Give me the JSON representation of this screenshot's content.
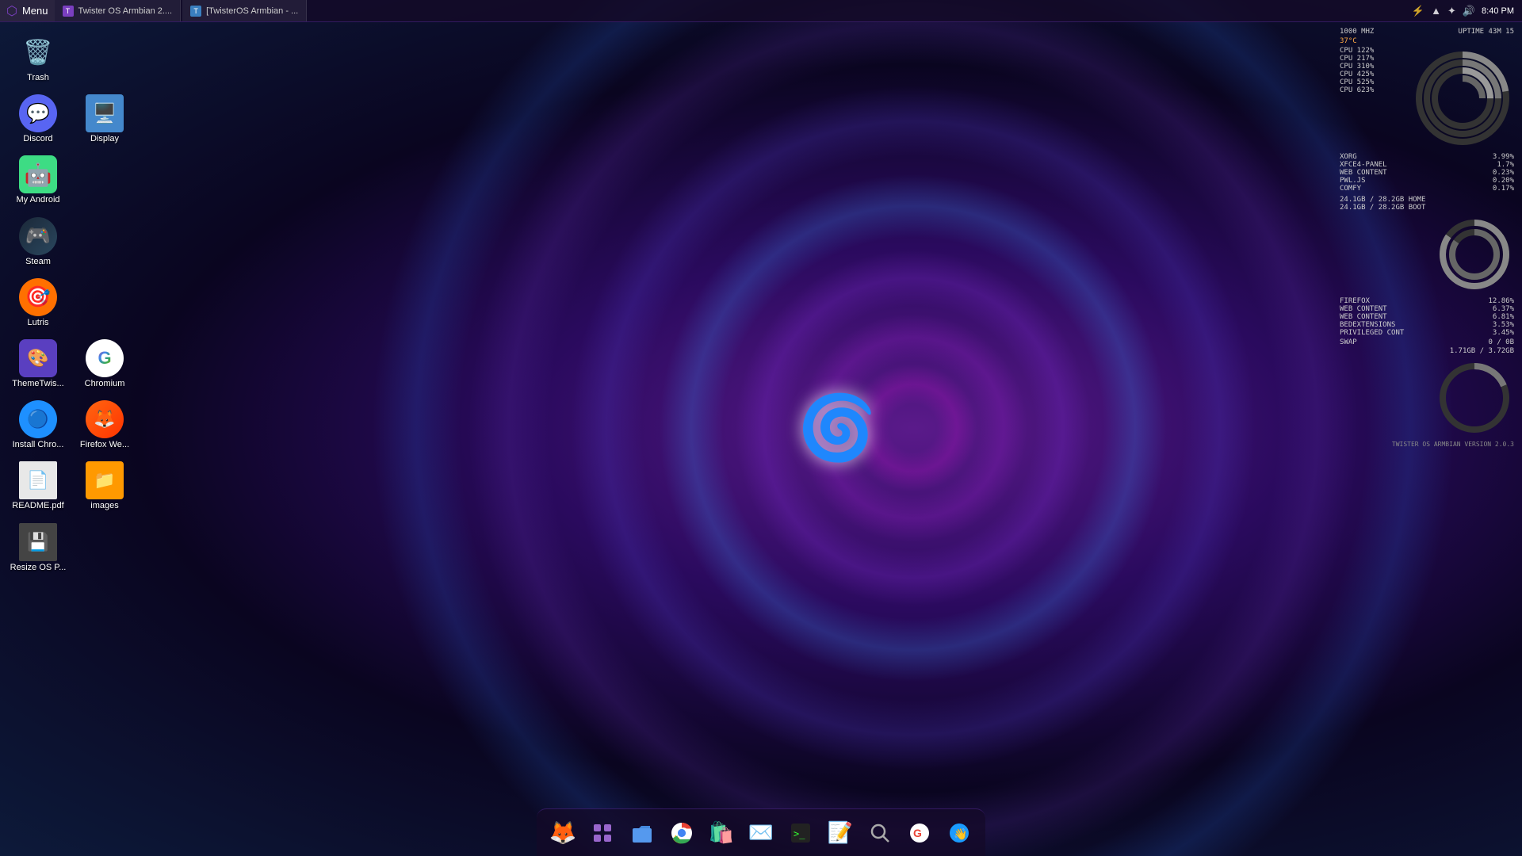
{
  "taskbar": {
    "menu_label": "Menu",
    "tab1_label": "Twister OS Armbian 2....",
    "tab2_label": "[TwisterOS Armbian - ...",
    "time": "8:40 PM",
    "icons": {
      "battery": "⚡",
      "wifi": "📶",
      "bluetooth": "🔵",
      "volume": "🔊"
    }
  },
  "desktop_icons": [
    {
      "id": "trash",
      "label": "Trash",
      "emoji": "🗑️",
      "color": "#888"
    },
    {
      "id": "discord",
      "label": "Discord",
      "emoji": "💬",
      "bg": "#5865F2"
    },
    {
      "id": "display",
      "label": "Display",
      "emoji": "🖥️",
      "bg": "#4a9eff"
    },
    {
      "id": "my-android",
      "label": "My Android",
      "emoji": "🤖",
      "bg": "#3ddc84"
    },
    {
      "id": "steam",
      "label": "Steam",
      "emoji": "🎮",
      "bg": "#1b2838"
    },
    {
      "id": "lutris",
      "label": "Lutris",
      "emoji": "🎯",
      "bg": "#ff7e00"
    },
    {
      "id": "themetwist",
      "label": "ThemeTwis...",
      "emoji": "🎨",
      "bg": "#5a3fc0"
    },
    {
      "id": "chromium",
      "label": "Chromium",
      "emoji": "🌐",
      "bg": "#fff"
    },
    {
      "id": "install-chro",
      "label": "Install Chro...",
      "emoji": "🔵",
      "bg": "#1e90ff"
    },
    {
      "id": "firefox-we",
      "label": "Firefox We...",
      "emoji": "🦊",
      "bg": "#ff6611"
    },
    {
      "id": "readme",
      "label": "README.pdf",
      "emoji": "📄",
      "bg": "#f0f0f0"
    },
    {
      "id": "images",
      "label": "images",
      "emoji": "📁",
      "bg": "#ff9900"
    },
    {
      "id": "resize-os",
      "label": "Resize OS P...",
      "emoji": "💾",
      "bg": "#555"
    }
  ],
  "sysmon": {
    "freq": "1000  MHZ",
    "uptime": "UPTIME 43M 15",
    "temp": "37°C",
    "cpu_rows": [
      {
        "label": "CPU 1",
        "pct": "22%"
      },
      {
        "label": "CPU 2",
        "pct": "17%"
      },
      {
        "label": "CPU 3",
        "pct": "10%"
      },
      {
        "label": "CPU 4",
        "pct": "25%"
      },
      {
        "label": "CPU 5",
        "pct": "25%"
      },
      {
        "label": "CPU 6",
        "pct": "23%"
      }
    ],
    "processes": [
      {
        "name": "XORG",
        "pct": "3.99%"
      },
      {
        "name": "XFCE4-PANEL",
        "pct": "1.7%"
      },
      {
        "name": "WEB CONTENT",
        "pct": "0.23%"
      },
      {
        "name": "PWL.JS",
        "pct": "0.20%"
      },
      {
        "name": "COMFY",
        "pct": "0.17%"
      }
    ],
    "disk": [
      {
        "label": "24.1GB / 28.2GB HOME"
      },
      {
        "label": "24.1GB / 28.2GB BOOT"
      }
    ],
    "mem_processes": [
      {
        "name": "FIREFOX",
        "pct": "12.86%"
      },
      {
        "name": "WEB CONTENT",
        "pct": "6.37%"
      },
      {
        "name": "WEB CONTENT",
        "pct": "6.81%"
      },
      {
        "name": "BEDEXTENSIONS",
        "pct": "3.53%"
      },
      {
        "name": "PRIVILEGED CONT",
        "pct": "3.45%"
      }
    ],
    "swap": "SWAP   0 / 0B",
    "mem": "1.71GB / 3.72GB",
    "version": "TWISTER OS ARMBIAN VERSION 2.0.3"
  },
  "dock": {
    "items": [
      {
        "id": "firefox-dock",
        "emoji": "🦊",
        "label": "Firefox",
        "bg": "#ff6611"
      },
      {
        "id": "apps-dock",
        "emoji": "⊞",
        "label": "Apps",
        "bg": "#5a3fc0"
      },
      {
        "id": "files-dock",
        "emoji": "📂",
        "label": "Files",
        "bg": "#4a9eff"
      },
      {
        "id": "chromium-dock",
        "emoji": "🌐",
        "label": "Chromium",
        "bg": "#ea4335"
      },
      {
        "id": "store-dock",
        "emoji": "🛍️",
        "label": "Store",
        "bg": "#666"
      },
      {
        "id": "email-dock",
        "emoji": "✉️",
        "label": "Email",
        "bg": "#cc3333"
      },
      {
        "id": "terminal-dock",
        "emoji": "⬛",
        "label": "Terminal",
        "bg": "#222"
      },
      {
        "id": "text-dock",
        "emoji": "📝",
        "label": "Text Editor",
        "bg": "#eee"
      },
      {
        "id": "search-dock",
        "emoji": "🔍",
        "label": "Search",
        "bg": "#555"
      },
      {
        "id": "google-dock",
        "emoji": "G",
        "label": "Google",
        "bg": "white"
      },
      {
        "id": "assistant-dock",
        "emoji": "👋",
        "label": "Assistant",
        "bg": "#1a9bff"
      }
    ]
  }
}
